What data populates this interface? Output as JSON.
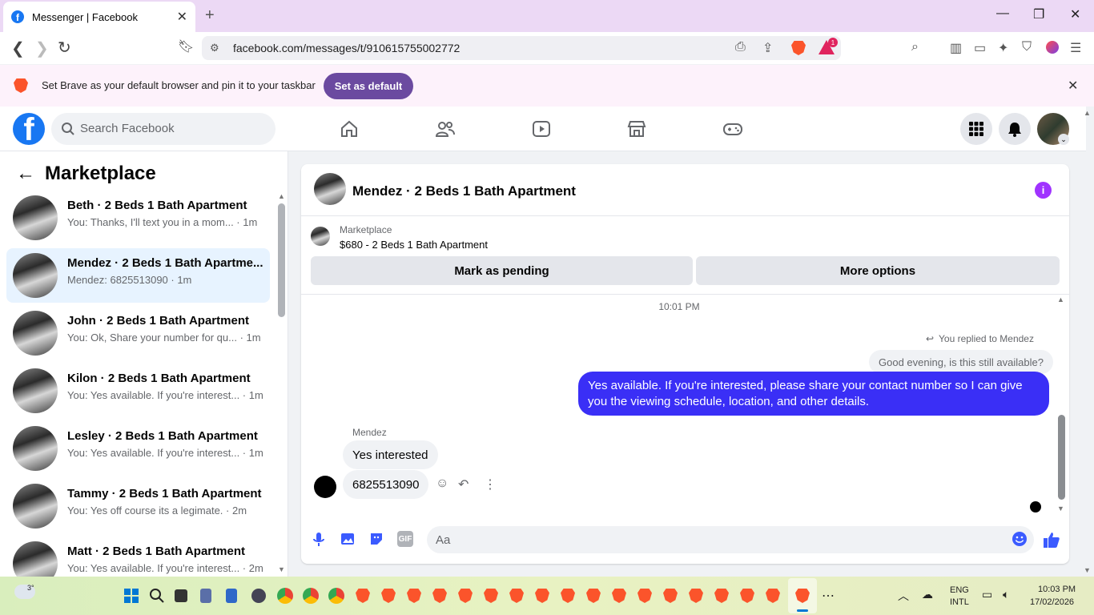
{
  "browser": {
    "tab_title": "Messenger | Facebook",
    "url": "facebook.com/messages/t/910615755002772",
    "notification_count": "1",
    "infobar_text": "Set Brave as your default browser and pin it to your taskbar",
    "set_default_label": "Set as default"
  },
  "fb": {
    "search_placeholder": "Search Facebook",
    "nav_icons": [
      "home-icon",
      "friends-icon",
      "watch-icon",
      "marketplace-icon",
      "gaming-icon"
    ]
  },
  "sidebar": {
    "title": "Marketplace",
    "conversations": [
      {
        "name": "Beth · 2 Beds 1 Bath Apartment",
        "preview": "You: Thanks, I'll text you in a mom... · 1m"
      },
      {
        "name": "Mendez · 2 Beds 1 Bath Apartme...",
        "preview": "Mendez: 6825513090 · 1m"
      },
      {
        "name": "John · 2 Beds 1 Bath Apartment",
        "preview": "You: Ok, Share your number for qu... · 1m"
      },
      {
        "name": "Kilon · 2 Beds 1 Bath Apartment",
        "preview": "You: Yes available. If you're interest... · 1m"
      },
      {
        "name": "Lesley · 2 Beds 1 Bath Apartment",
        "preview": "You: Yes available. If you're interest... · 1m"
      },
      {
        "name": "Tammy · 2 Beds 1 Bath Apartment",
        "preview": "You: Yes off course its a legimate. · 2m"
      },
      {
        "name": "Matt · 2 Beds 1 Bath Apartment",
        "preview": "You: Yes available. If you're interest... · 2m"
      }
    ]
  },
  "chat": {
    "title": "Mendez · 2 Beds 1 Bath Apartment",
    "listing_label": "Marketplace",
    "listing_price": "$680 - 2 Beds 1 Bath Apartment",
    "mark_pending_label": "Mark as pending",
    "more_options_label": "More options",
    "timestamp": "10:01 PM",
    "replied_to": "You replied to Mendez",
    "quoted_message": "Good evening, is this still available?",
    "outgoing_message": "Yes available. If you're interested, please share your contact number so I can give you the viewing schedule, location, and other details.",
    "sender_name": "Mendez",
    "incoming_messages": [
      "Yes interested",
      "6825513090"
    ],
    "composer_placeholder": "Aa"
  },
  "taskbar": {
    "weather": "3°",
    "language": "ENG",
    "layout": "INTL",
    "time": "10:03 PM",
    "date": "17/02/2026"
  },
  "colors": {
    "fb_blue": "#1877f2",
    "outgoing_bubble": "#3a2ff6",
    "brave_purple": "#6b4aa0",
    "active_conversation": "#e7f3ff"
  }
}
